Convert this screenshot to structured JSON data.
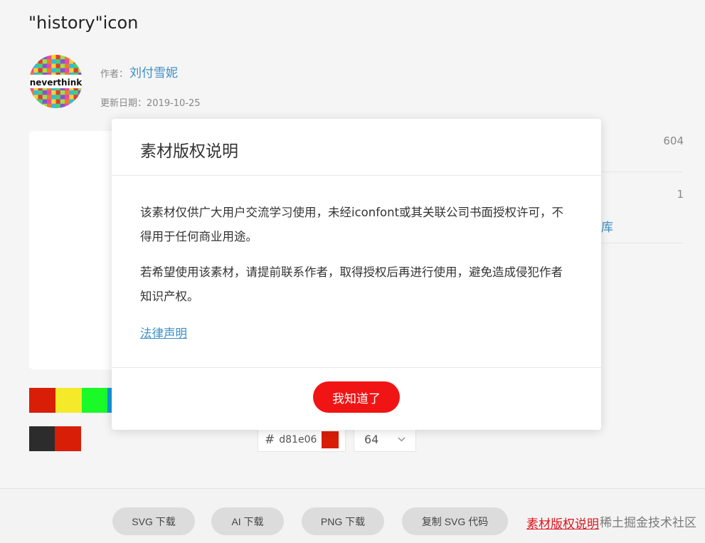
{
  "page": {
    "title": "\"history\"icon"
  },
  "author": {
    "label": "作者：",
    "name": "刘付雪妮",
    "avatar_text": "neverthink",
    "date_label": "更新日期：",
    "date": "2019-10-25"
  },
  "stats": {
    "count_a": "604",
    "count_b": "1",
    "library_fragment": "库"
  },
  "palette": {
    "row1": [
      "#d81e06",
      "#f4ea2a",
      "#1afa29",
      "#1296db"
    ],
    "row2": [
      "#2c2c2c",
      "#d81e06"
    ]
  },
  "color_input": {
    "hash": "#",
    "value": "d81e06",
    "chip_color": "#d81e06"
  },
  "size_select": {
    "value": "64"
  },
  "bottom_bar": {
    "svg_download": "SVG 下载",
    "ai_download": "AI 下载",
    "png_download": "PNG 下载",
    "copy_svg": "复制 SVG 代码",
    "copyright_link": "素材版权说明",
    "watermark": "稀土掘金技术社区"
  },
  "modal": {
    "title": "素材版权说明",
    "paragraph1": "该素材仅供广大用户交流学习使用，未经iconfont或其关联公司书面授权许可，不得用于任何商业用途。",
    "paragraph2": "若希望使用该素材，请提前联系作者，取得授权后再进行使用，避免造成侵犯作者知识产权。",
    "legal_link": "法律声明",
    "ok_button": "我知道了"
  },
  "colors": {
    "accent_red": "#f01414",
    "link_blue": "#3b8fc6",
    "copyright_red": "#e0131a"
  }
}
